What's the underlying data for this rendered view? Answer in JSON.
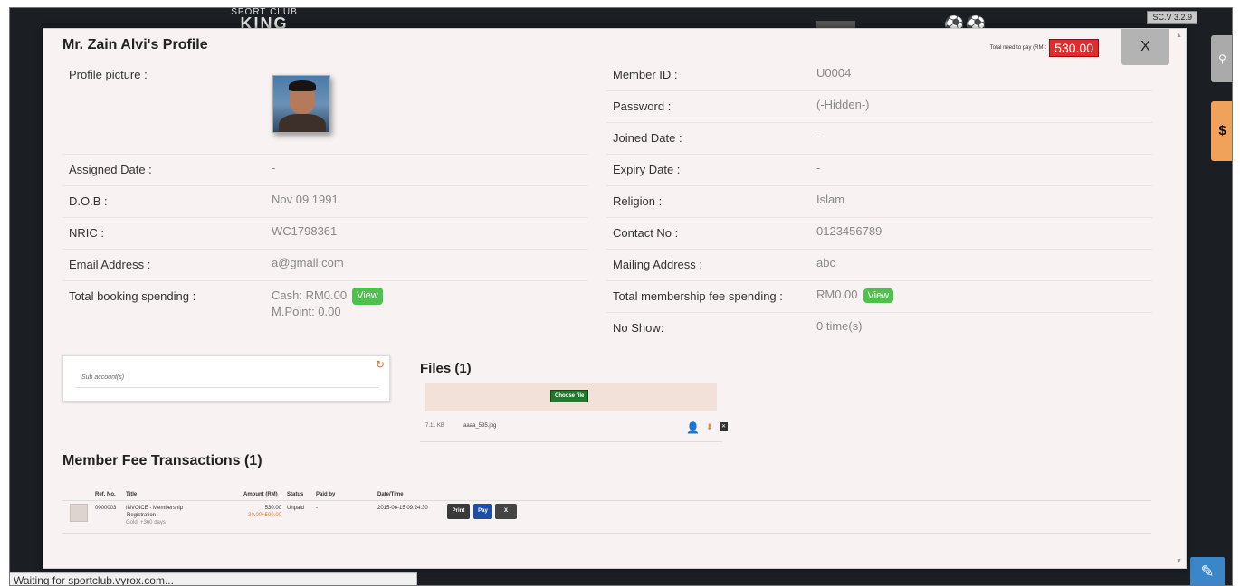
{
  "background": {
    "brand_top": "SPORT CLUB",
    "brand_main": "KING",
    "version": "SC.V 3.2.9",
    "status_bar": "Waiting for sportclub.vyrox.com..."
  },
  "modal": {
    "title": "Mr. Zain Alvi's Profile",
    "total_label": "Total need to pay (RM):",
    "total_amount": "530.00",
    "close_label": "X"
  },
  "profile": {
    "picture_label": "Profile picture :",
    "member_id_label": "Member ID :",
    "member_id": "U0004",
    "password_label": "Password :",
    "password": "(-Hidden-)",
    "joined_date_label": "Joined Date :",
    "joined_date": "-",
    "assigned_date_label": "Assigned Date :",
    "assigned_date": "-",
    "expiry_date_label": "Expiry Date :",
    "expiry_date": "-",
    "dob_label": "D.O.B :",
    "dob": "Nov 09 1991",
    "religion_label": "Religion :",
    "religion": "Islam",
    "nric_label": "NRIC :",
    "nric": "WC1798361",
    "contact_label": "Contact No :",
    "contact": "0123456789",
    "email_label": "Email Address :",
    "email": "a@gmail.com",
    "mailing_label": "Mailing Address :",
    "mailing": "abc",
    "booking_label": "Total booking spending :",
    "booking_cash": "Cash: RM0.00",
    "booking_points": "M.Point: 0.00",
    "membership_label": "Total membership fee spending :",
    "membership_value": "RM0.00",
    "view_label": "View",
    "noshow_label": "No Show:",
    "noshow_value": "0 time(s)"
  },
  "sub_accounts": {
    "label": "Sub account(s)"
  },
  "files": {
    "title": "Files (1)",
    "choose_label": "Choose file",
    "items": [
      {
        "size": "7.11 KB",
        "name": "aaaa_535.jpg"
      }
    ]
  },
  "transactions": {
    "title": "Member Fee Transactions (1)",
    "headers": {
      "ref": "Ref. No.",
      "title": "Title",
      "amount": "Amount (RM)",
      "status": "Status",
      "paid_by": "Paid by",
      "datetime": "Date/Time"
    },
    "rows": [
      {
        "ref": "0000003",
        "title_1": "INVOICE - Membership",
        "title_2": "Registration",
        "title_3": "Gold, +360 days",
        "amount": "530.00",
        "amount_detail": "30.00+500.00",
        "status": "Unpaid",
        "paid_by": "-",
        "datetime": "2015-06-15 09:24:30",
        "print_label": "Print",
        "pay_label": "Pay",
        "delete_label": "X"
      }
    ]
  },
  "colors": {
    "accent_red": "#e32b2b",
    "view_green": "#4cc14c",
    "pay_blue": "#1e4fa8"
  }
}
